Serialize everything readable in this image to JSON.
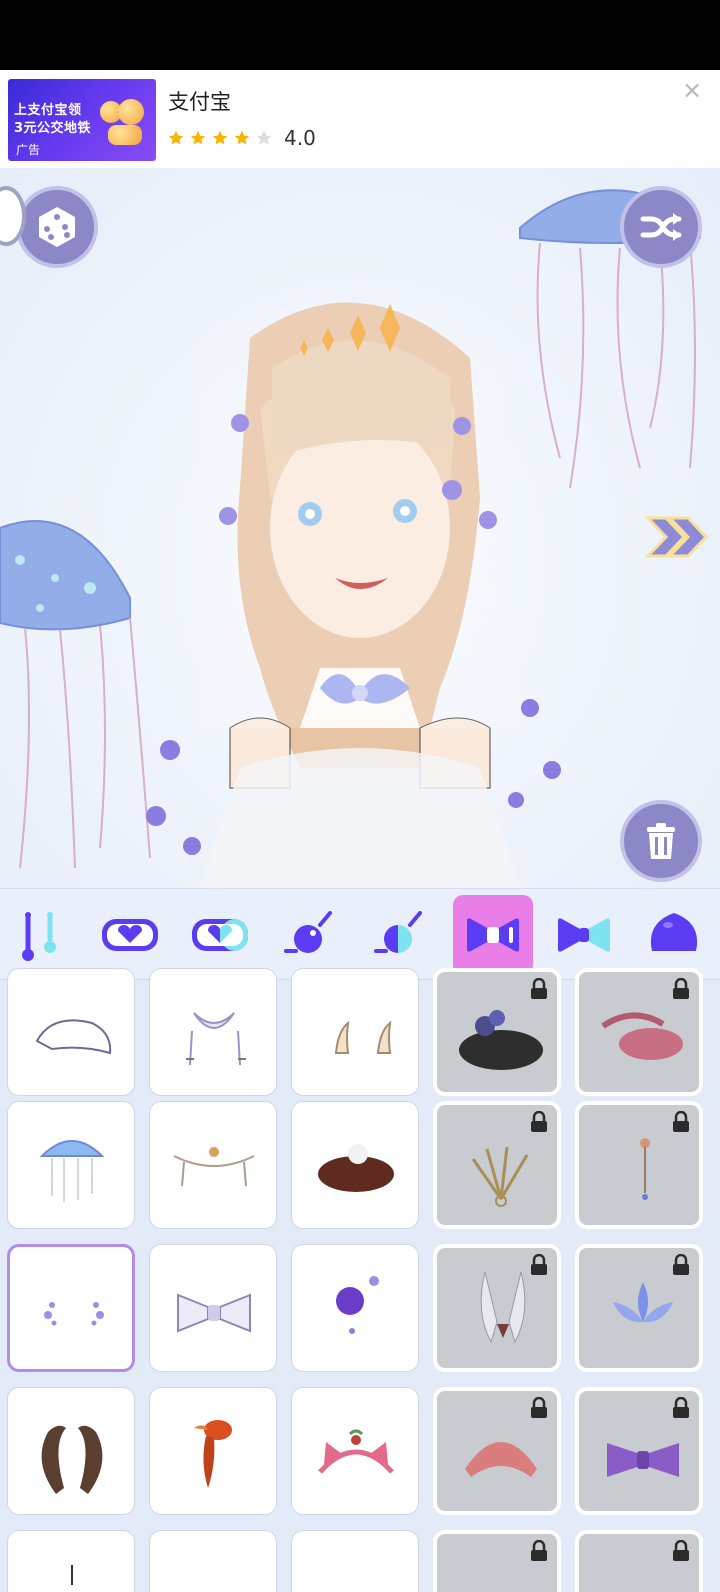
{
  "ad": {
    "image_lines": [
      "上支付宝领",
      "3元公交地铁"
    ],
    "image_tag": "广告",
    "title": "支付宝",
    "rating": "4.0",
    "stars_filled": 4,
    "stars_total": 5,
    "close_label": "×"
  },
  "stage": {
    "buttons": [
      "dice-button",
      "shuffle-button",
      "delete-button",
      "next-button"
    ]
  },
  "categories": [
    {
      "name": "swing",
      "active": false
    },
    {
      "name": "heart-badge",
      "active": false
    },
    {
      "name": "heart-badge-2",
      "active": false
    },
    {
      "name": "ball-pin",
      "active": false
    },
    {
      "name": "ball-pin-2",
      "active": false
    },
    {
      "name": "bow",
      "active": true
    },
    {
      "name": "bow-2",
      "active": false
    },
    {
      "name": "blob",
      "active": false
    }
  ],
  "items": [
    [
      {
        "art": "white-beret",
        "locked": false
      },
      {
        "art": "ribbon-crosses",
        "locked": false
      },
      {
        "art": "horns-small",
        "locked": false
      },
      {
        "art": "black-flower-hat",
        "locked": true
      },
      {
        "art": "feather-hat",
        "locked": true
      }
    ],
    [
      {
        "art": "jellyfish",
        "locked": false
      },
      {
        "art": "pearl-chain",
        "locked": false
      },
      {
        "art": "bird-nest",
        "locked": false
      },
      {
        "art": "feather-fan",
        "locked": true
      },
      {
        "art": "hair-pin",
        "locked": true
      }
    ],
    [
      {
        "art": "flower-sparkles",
        "locked": false,
        "selected": true
      },
      {
        "art": "lace-bow",
        "locked": false
      },
      {
        "art": "purple-rose",
        "locked": false
      },
      {
        "art": "fairy-wings",
        "locked": true
      },
      {
        "art": "lotus",
        "locked": true
      }
    ],
    [
      {
        "art": "ram-horns",
        "locked": false
      },
      {
        "art": "goldfish",
        "locked": false
      },
      {
        "art": "cat-ear-headband",
        "locked": false
      },
      {
        "art": "pink-beret",
        "locked": true
      },
      {
        "art": "purple-bow",
        "locked": true
      }
    ],
    [
      {
        "art": "partial",
        "locked": false
      },
      {
        "art": "partial",
        "locked": false
      },
      {
        "art": "partial",
        "locked": false
      },
      {
        "art": "partial",
        "locked": true
      },
      {
        "art": "partial",
        "locked": true
      }
    ]
  ],
  "colors": {
    "accent": "#ea7ee9",
    "button": "#8c88c8",
    "icon": "#5b3cf2",
    "icon_light": "#7ee3f0"
  }
}
